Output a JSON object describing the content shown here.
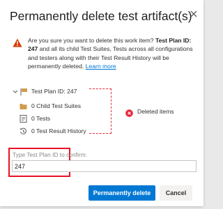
{
  "dialog": {
    "title": "Permanently delete test artifact(s)",
    "close_icon": "close-icon"
  },
  "warning": {
    "icon": "warning-icon",
    "icon_color": "#d83b01",
    "text_1": "Are you sure you want to delete this work item? ",
    "bold_1": "Test Plan ID: 247",
    "text_2": " and all its child Test Suites, Tests across all configurations and testers along with their Test Result History will be permanently deleted. ",
    "link": "Learn more"
  },
  "tree": {
    "root": {
      "label": "Test Plan ID: 247",
      "icon": "test-plan-icon",
      "toggle_icon": "chevron-down-icon"
    },
    "children": [
      {
        "label": "0 Child Test Suites",
        "icon": "folder-icon"
      },
      {
        "label": "0 Tests",
        "icon": "test-case-icon"
      },
      {
        "label": "0 Test Result History",
        "icon": "history-icon"
      }
    ]
  },
  "deleted_marker": {
    "icon": "delete-x-icon",
    "label": "Deleted items",
    "color": "#e3263b"
  },
  "confirm": {
    "label": "Type Test Plan ID to confirm:",
    "value": "247",
    "highlight_color": "#e81123"
  },
  "buttons": {
    "primary": "Permanently delete",
    "secondary": "Cancel",
    "primary_color": "#0078d4"
  }
}
